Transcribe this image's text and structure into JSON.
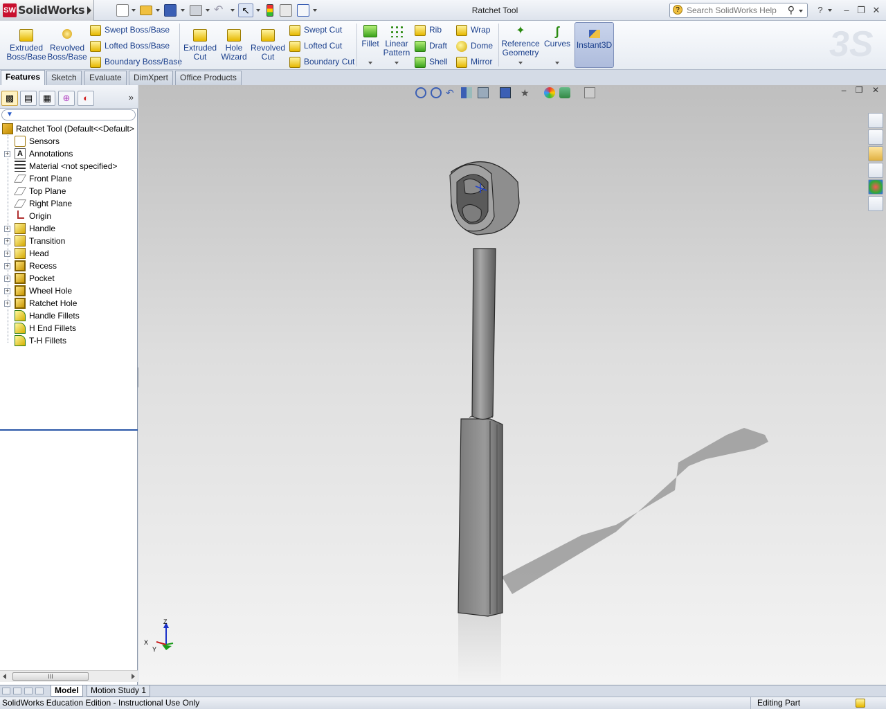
{
  "app": {
    "name": "SolidWorks",
    "logo_text": "SW",
    "document_title": "Ratchet Tool"
  },
  "search": {
    "placeholder": "Search SolidWorks Help"
  },
  "window_controls": {
    "help": "?",
    "minimize": "–",
    "restore": "❐",
    "close": "✕"
  },
  "ribbon": {
    "extruded_boss": [
      "Extruded",
      "Boss/Base"
    ],
    "revolved_boss": [
      "Revolved",
      "Boss/Base"
    ],
    "swept_boss": "Swept Boss/Base",
    "lofted_boss": "Lofted Boss/Base",
    "boundary_boss": "Boundary Boss/Base",
    "extruded_cut": [
      "Extruded",
      "Cut"
    ],
    "hole_wizard": [
      "Hole",
      "Wizard"
    ],
    "revolved_cut": [
      "Revolved",
      "Cut"
    ],
    "swept_cut": "Swept Cut",
    "lofted_cut": "Lofted Cut",
    "boundary_cut": "Boundary Cut",
    "fillet": "Fillet",
    "linear_pattern": [
      "Linear",
      "Pattern"
    ],
    "rib": "Rib",
    "draft": "Draft",
    "shell": "Shell",
    "wrap": "Wrap",
    "dome": "Dome",
    "mirror": "Mirror",
    "reference_geometry": [
      "Reference",
      "Geometry"
    ],
    "curves": "Curves",
    "instant3d": "Instant3D"
  },
  "tabs": [
    "Features",
    "Sketch",
    "Evaluate",
    "DimXpert",
    "Office Products"
  ],
  "active_tab": "Features",
  "panel": {
    "expand": "»"
  },
  "tree": {
    "root": "Ratchet Tool  (Default<<Default>",
    "items": [
      {
        "label": "Sensors",
        "icon": "sensor-icon",
        "expandable": false
      },
      {
        "label": "Annotations",
        "icon": "annotations-icon",
        "expandable": true
      },
      {
        "label": "Material <not specified>",
        "icon": "material-icon",
        "expandable": false
      },
      {
        "label": "Front Plane",
        "icon": "plane-icon",
        "expandable": false
      },
      {
        "label": "Top Plane",
        "icon": "plane-icon",
        "expandable": false
      },
      {
        "label": "Right Plane",
        "icon": "plane-icon",
        "expandable": false
      },
      {
        "label": "Origin",
        "icon": "origin-icon",
        "expandable": false
      },
      {
        "label": "Handle",
        "icon": "boss-feature-icon",
        "expandable": true
      },
      {
        "label": "Transition",
        "icon": "boss-feature-icon",
        "expandable": true
      },
      {
        "label": "Head",
        "icon": "boss-feature-icon",
        "expandable": true
      },
      {
        "label": "Recess",
        "icon": "cut-feature-icon",
        "expandable": true
      },
      {
        "label": "Pocket",
        "icon": "cut-feature-icon",
        "expandable": true
      },
      {
        "label": "Wheel Hole",
        "icon": "cut-feature-icon",
        "expandable": true
      },
      {
        "label": "Ratchet Hole",
        "icon": "cut-feature-icon",
        "expandable": true
      },
      {
        "label": "Handle Fillets",
        "icon": "fillet-icon",
        "expandable": false
      },
      {
        "label": "H End Fillets",
        "icon": "fillet-icon",
        "expandable": false
      },
      {
        "label": "T-H Fillets",
        "icon": "fillet-icon",
        "expandable": false
      }
    ]
  },
  "scrollbar": {
    "thumb_grip": "III"
  },
  "bottom_tabs": [
    "Model",
    "Motion Study 1"
  ],
  "status": {
    "left": "SolidWorks Education Edition - Instructional Use Only",
    "right": "Editing Part"
  },
  "colors": {
    "accent_blue": "#1a3f8c",
    "selection": "#2855a6",
    "brand_red": "#c8102e"
  }
}
